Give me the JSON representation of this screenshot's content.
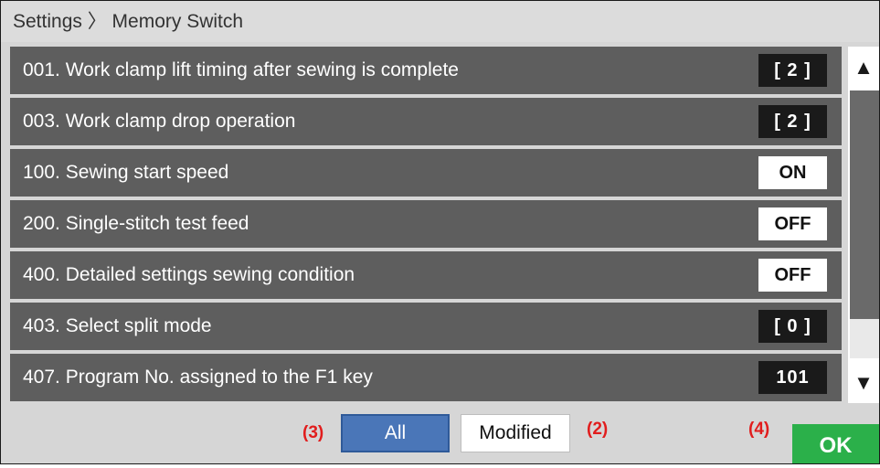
{
  "header": {
    "breadcrumb": "Settings 〉 Memory Switch"
  },
  "rows": [
    {
      "label": "001. Work clamp lift timing after sewing is complete",
      "value": "[ 2 ]",
      "style": "dark"
    },
    {
      "label": "003. Work clamp drop operation",
      "value": "[ 2 ]",
      "style": "dark"
    },
    {
      "label": "100. Sewing start speed",
      "value": "ON",
      "style": "light"
    },
    {
      "label": "200. Single-stitch test feed",
      "value": "OFF",
      "style": "light"
    },
    {
      "label": "400. Detailed settings sewing condition",
      "value": "OFF",
      "style": "light"
    },
    {
      "label": "403. Select split mode",
      "value": "[ 0 ]",
      "style": "dark"
    },
    {
      "label": "407. Program No. assigned to the F1 key",
      "value": "101",
      "style": "dark"
    }
  ],
  "scrollbar": {
    "up_icon": "triangle-up-icon",
    "down_icon": "triangle-down-icon",
    "up_glyph": "▲",
    "down_glyph": "▼"
  },
  "footer": {
    "annotation_all": "(3)",
    "all_label": "All",
    "modified_label": "Modified",
    "annotation_modified": "(2)",
    "annotation_ok": "(4)",
    "ok_label": "OK"
  },
  "colors": {
    "row_bg": "#5e5e5e",
    "value_dark": "#1a1a1a",
    "value_light": "#ffffff",
    "selected_tab": "#4a76b8",
    "ok_green": "#2bb04a",
    "annotation_red": "#e11d1d"
  }
}
